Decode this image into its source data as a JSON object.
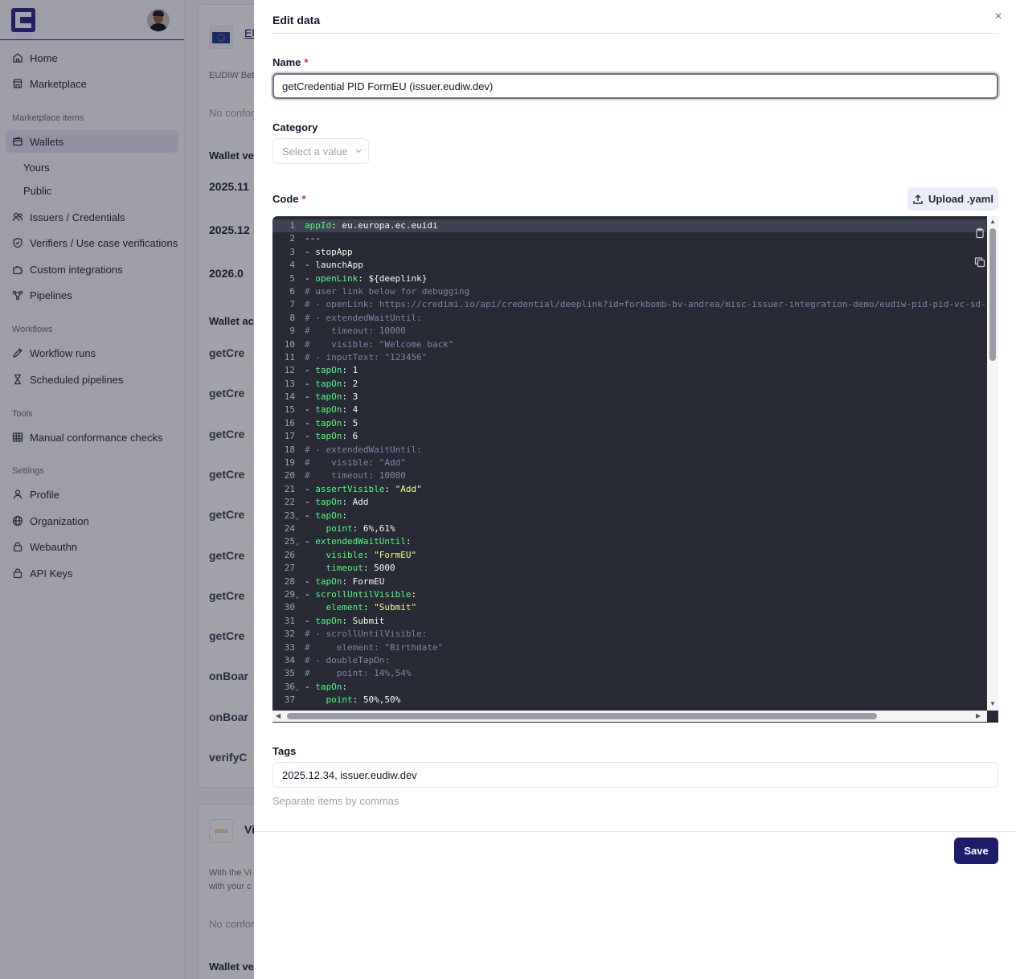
{
  "sidebar": {
    "nav": [
      {
        "label": "Home",
        "icon": "home-icon"
      },
      {
        "label": "Marketplace",
        "icon": "store-icon"
      }
    ],
    "sections": {
      "marketplace": "Marketplace items",
      "workflows": "Workflows",
      "tools": "Tools",
      "settings": "Settings"
    },
    "marketplace_items": {
      "wallets": "Wallets",
      "yours": "Yours",
      "public": "Public",
      "issuers": "Issuers / Credentials",
      "verifiers": "Verifiers / Use case verifications",
      "custom": "Custom integrations",
      "pipelines": "Pipelines"
    },
    "workflows": {
      "runs": "Workflow runs",
      "scheduled": "Scheduled pipelines"
    },
    "tools": {
      "manual": "Manual conformance checks"
    },
    "settings": {
      "profile": "Profile",
      "organization": "Organization",
      "webauthn": "Webauthn",
      "apikeys": "API Keys"
    }
  },
  "background": {
    "title": "EU",
    "subtitle": "EUDIW Beta",
    "no_conform": "No confor",
    "wallet_versions": "Wallet ver",
    "versions": [
      "2025.11",
      "2025.12",
      "2026.0"
    ],
    "wallet_actions": "Wallet act",
    "actions": [
      "getCre",
      "getCre",
      "getCre",
      "getCre",
      "getCre",
      "getCre",
      "getCre",
      "getCre",
      "onBoar",
      "onBoar",
      "verifyC"
    ],
    "card2_title": "Vi",
    "card2_logo": "vidua",
    "card2_desc1": "With the Vi",
    "card2_desc2": "with your c",
    "card2_no_conform": "No confor",
    "card2_wallet_versions": "Wallet ver"
  },
  "drawer": {
    "title": "Edit data",
    "close": "×",
    "name_label": "Name",
    "name_value": "getCredential PID FormEU (issuer.eudiw.dev)",
    "category_label": "Category",
    "category_placeholder": "Select a value",
    "code_label": "Code",
    "required_mark": "*",
    "upload_label": "Upload .yaml",
    "tags_label": "Tags",
    "tags_value": "2025.12.34, issuer.eudiw.dev",
    "tags_hint": "Separate items by commas",
    "save_label": "Save"
  },
  "code": [
    [
      [
        "k",
        "appId"
      ],
      [
        "t",
        ": eu.europa.ec.euidi"
      ]
    ],
    [
      [
        "t",
        "---"
      ]
    ],
    [
      [
        "t",
        "- stopApp"
      ]
    ],
    [
      [
        "t",
        "- launchApp"
      ]
    ],
    [
      [
        "t",
        "- "
      ],
      [
        "k",
        "openLink"
      ],
      [
        "t",
        ": ${deeplink}"
      ]
    ],
    [
      [
        "c",
        "# user link below for debugging"
      ]
    ],
    [
      [
        "c",
        "# - openLink: https://credimi.io/api/credential/deeplink?id=forkbomb-bv-andrea/misc-issuer-integration-demo/eudiw-pid-pid-vc-sd-jwt-"
      ]
    ],
    [
      [
        "c",
        "# - extendedWaitUntil:"
      ]
    ],
    [
      [
        "c",
        "#    timeout: 10000"
      ]
    ],
    [
      [
        "c",
        "#    visible: \"Welcome back\""
      ]
    ],
    [
      [
        "c",
        "# - inputText: \"123456\""
      ]
    ],
    [
      [
        "t",
        "- "
      ],
      [
        "k",
        "tapOn"
      ],
      [
        "t",
        ": 1"
      ]
    ],
    [
      [
        "t",
        "- "
      ],
      [
        "k",
        "tapOn"
      ],
      [
        "t",
        ": 2"
      ]
    ],
    [
      [
        "t",
        "- "
      ],
      [
        "k",
        "tapOn"
      ],
      [
        "t",
        ": 3"
      ]
    ],
    [
      [
        "t",
        "- "
      ],
      [
        "k",
        "tapOn"
      ],
      [
        "t",
        ": 4"
      ]
    ],
    [
      [
        "t",
        "- "
      ],
      [
        "k",
        "tapOn"
      ],
      [
        "t",
        ": 5"
      ]
    ],
    [
      [
        "t",
        "- "
      ],
      [
        "k",
        "tapOn"
      ],
      [
        "t",
        ": 6"
      ]
    ],
    [
      [
        "c",
        "# - extendedWaitUntil:"
      ]
    ],
    [
      [
        "c",
        "#    visible: \"Add\""
      ]
    ],
    [
      [
        "c",
        "#    timeout: 10000"
      ]
    ],
    [
      [
        "t",
        "- "
      ],
      [
        "k",
        "assertVisible"
      ],
      [
        "t",
        ": "
      ],
      [
        "s",
        "\"Add\""
      ]
    ],
    [
      [
        "t",
        "- "
      ],
      [
        "k",
        "tapOn"
      ],
      [
        "t",
        ": Add"
      ]
    ],
    [
      [
        "t",
        "- "
      ],
      [
        "k",
        "tapOn"
      ],
      [
        "t",
        ":"
      ]
    ],
    [
      [
        "t",
        "    "
      ],
      [
        "k",
        "point"
      ],
      [
        "t",
        ": 6%,61%"
      ]
    ],
    [
      [
        "t",
        "- "
      ],
      [
        "k",
        "extendedWaitUntil"
      ],
      [
        "t",
        ":"
      ]
    ],
    [
      [
        "t",
        "    "
      ],
      [
        "k",
        "visible"
      ],
      [
        "t",
        ": "
      ],
      [
        "s",
        "\"FormEU\""
      ]
    ],
    [
      [
        "t",
        "    "
      ],
      [
        "k",
        "timeout"
      ],
      [
        "t",
        ": 5000"
      ]
    ],
    [
      [
        "t",
        "- "
      ],
      [
        "k",
        "tapOn"
      ],
      [
        "t",
        ": FormEU"
      ]
    ],
    [
      [
        "t",
        "- "
      ],
      [
        "k",
        "scrollUntilVisible"
      ],
      [
        "t",
        ":"
      ]
    ],
    [
      [
        "t",
        "    "
      ],
      [
        "k",
        "element"
      ],
      [
        "t",
        ": "
      ],
      [
        "s",
        "\"Submit\""
      ]
    ],
    [
      [
        "t",
        "- "
      ],
      [
        "k",
        "tapOn"
      ],
      [
        "t",
        ": Submit"
      ]
    ],
    [
      [
        "c",
        "# - scrollUntilVisible:"
      ]
    ],
    [
      [
        "c",
        "#     element: \"Birthdate\""
      ]
    ],
    [
      [
        "c",
        "# - doubleTapOn:"
      ]
    ],
    [
      [
        "c",
        "#     point: 14%,54%"
      ]
    ],
    [
      [
        "t",
        "- "
      ],
      [
        "k",
        "tapOn"
      ],
      [
        "t",
        ":"
      ]
    ],
    [
      [
        "t",
        "    "
      ],
      [
        "k",
        "point"
      ],
      [
        "t",
        ": 50%,50%"
      ]
    ]
  ],
  "fold_lines": [
    23,
    25,
    29,
    36
  ],
  "colors": {
    "brand": "#1e1b6b",
    "editor_bg": "#282a36",
    "keyword": "#50fa7b",
    "string": "#f1fa8c",
    "comment": "#7f83a6",
    "required": "#e11d48"
  }
}
